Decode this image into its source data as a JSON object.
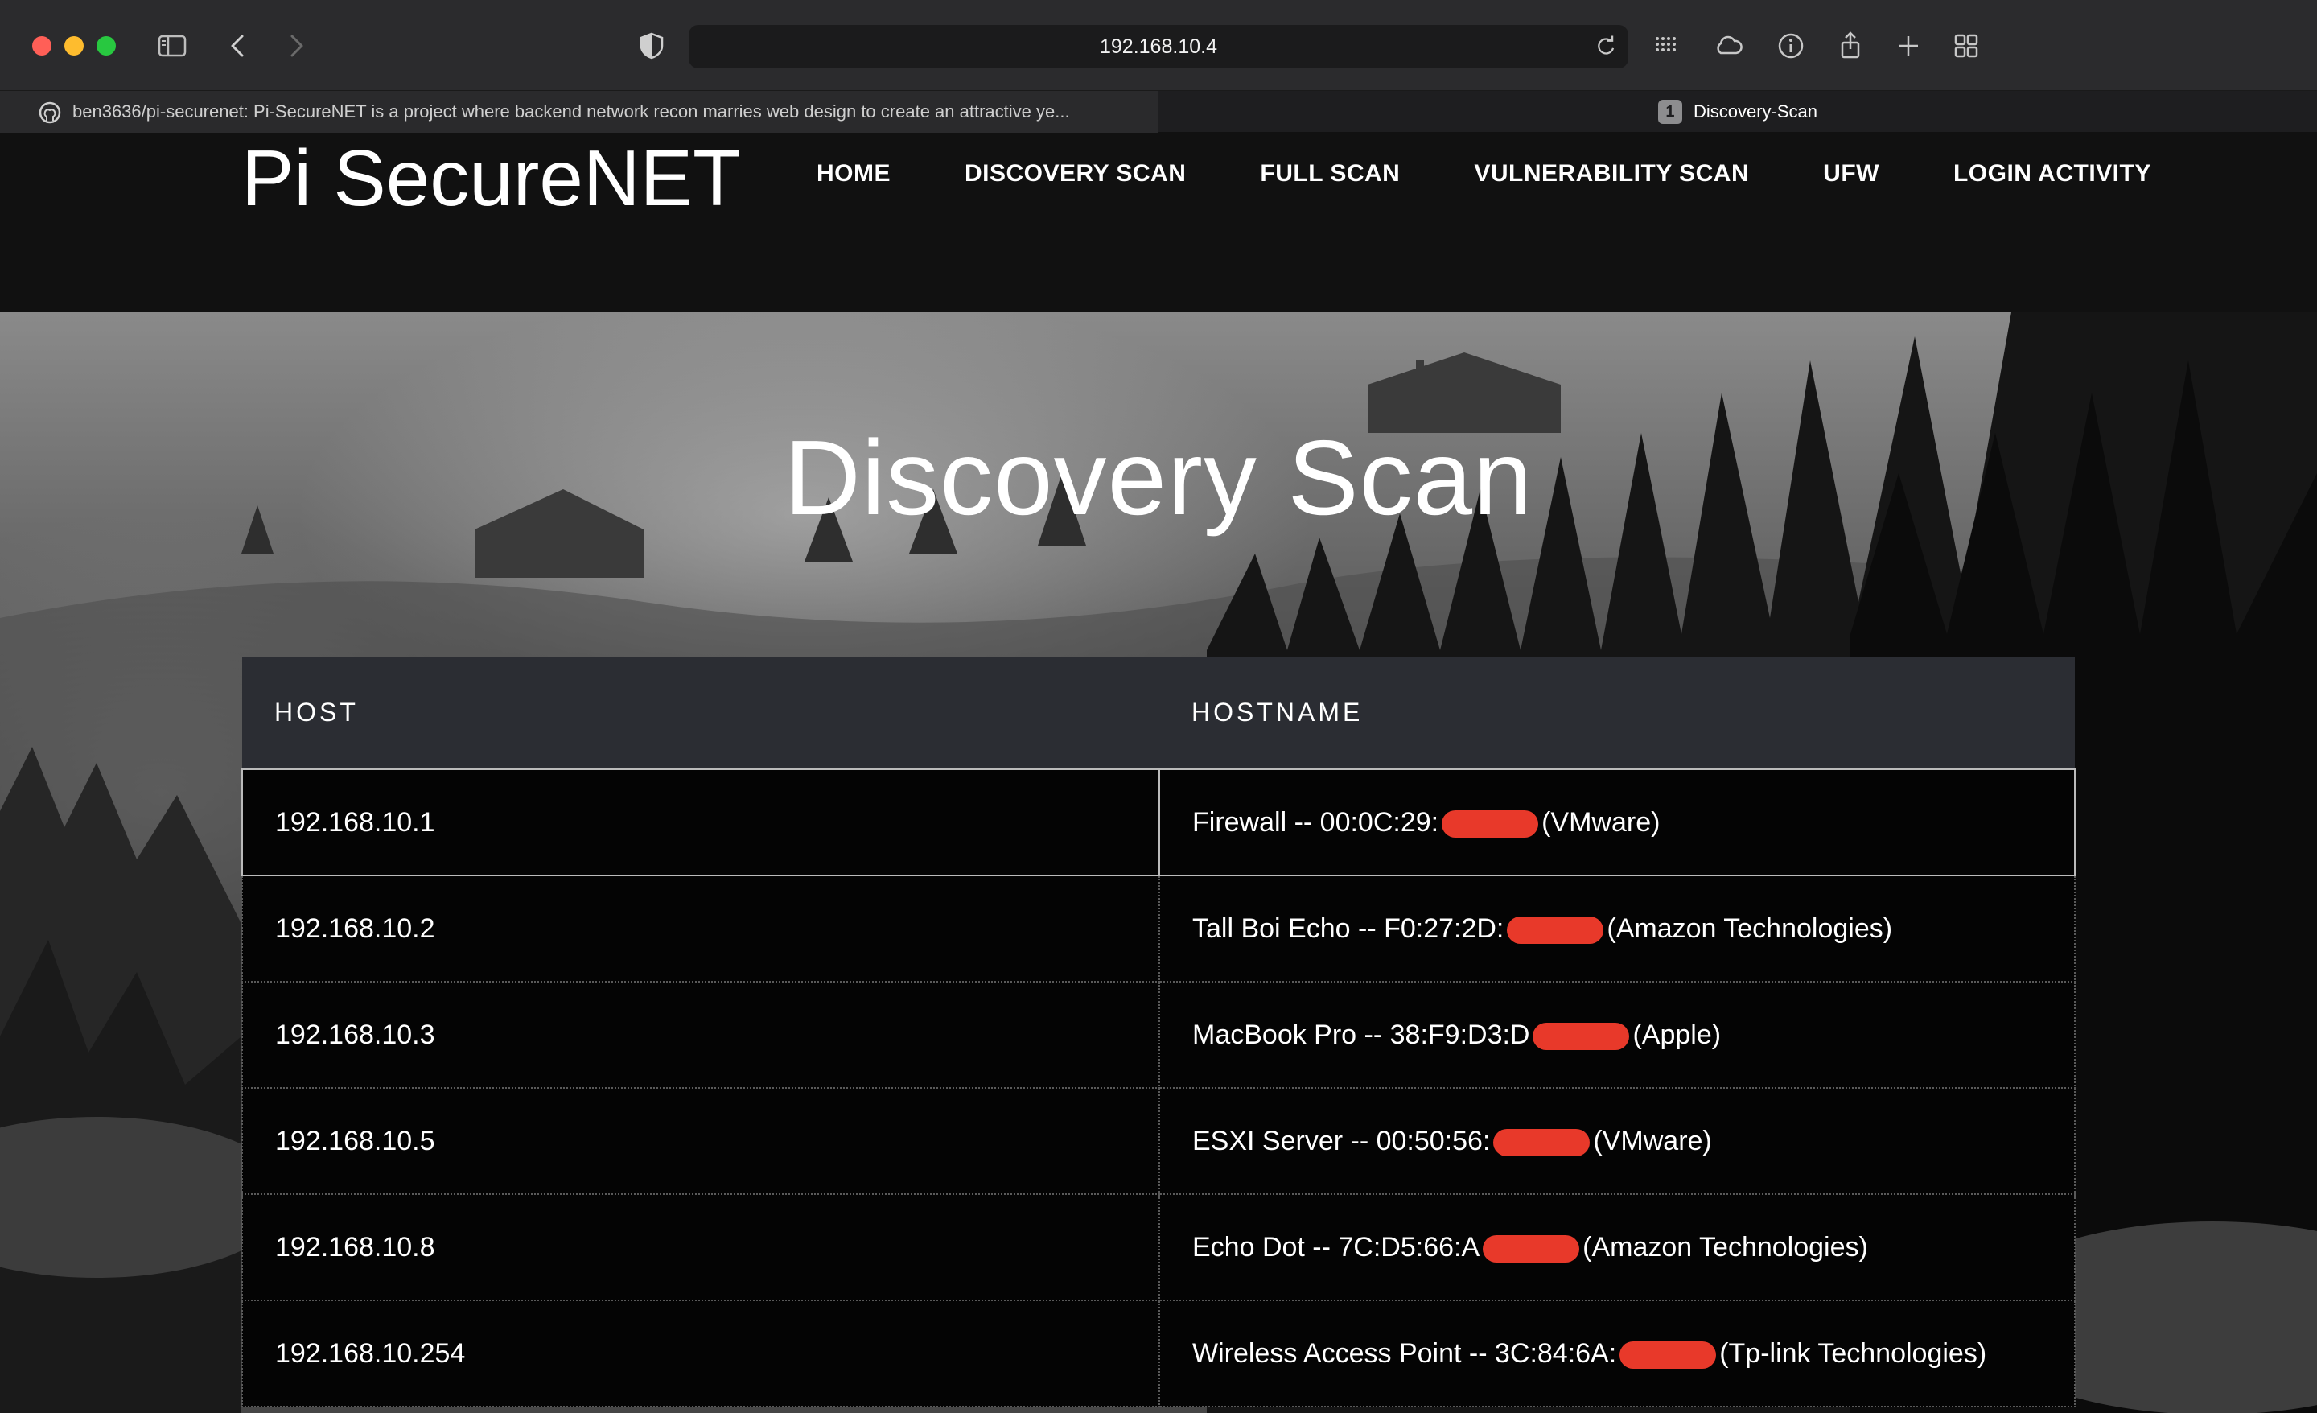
{
  "browser": {
    "url": "192.168.10.4",
    "tabs": [
      {
        "title": "ben3636/pi-securenet: Pi-SecureNET is a project where backend network recon marries web design to create an attractive ye...",
        "active": false
      },
      {
        "title": "Discovery-Scan",
        "active": true,
        "badge": "1"
      }
    ],
    "icons": [
      "sidebar-icon",
      "back-icon",
      "forward-icon",
      "shield-icon",
      "reload-icon",
      "extensions-grid-icon",
      "cloud-icon",
      "info-icon",
      "share-icon",
      "plus-icon",
      "tab-overview-icon"
    ]
  },
  "site": {
    "logo": "Pi SecureNET",
    "nav": [
      "HOME",
      "DISCOVERY SCAN",
      "FULL SCAN",
      "VULNERABILITY SCAN",
      "UFW",
      "LOGIN ACTIVITY"
    ]
  },
  "page": {
    "title": "Discovery Scan",
    "table": {
      "columns": [
        "HOST",
        "HOSTNAME"
      ],
      "rows": [
        {
          "host": "192.168.10.1",
          "name_prefix": "Firewall -- 00:0C:29:",
          "name_suffix": "(VMware)"
        },
        {
          "host": "192.168.10.2",
          "name_prefix": "Tall Boi Echo -- F0:27:2D:",
          "name_suffix": "(Amazon Technologies)"
        },
        {
          "host": "192.168.10.3",
          "name_prefix": "MacBook Pro -- 38:F9:D3:D",
          "name_suffix": "(Apple)"
        },
        {
          "host": "192.168.10.5",
          "name_prefix": "ESXI Server -- 00:50:56:",
          "name_suffix": "(VMware)"
        },
        {
          "host": "192.168.10.8",
          "name_prefix": "Echo Dot -- 7C:D5:66:A",
          "name_suffix": "(Amazon Technologies)"
        },
        {
          "host": "192.168.10.254",
          "name_prefix": "Wireless Access Point -- 3C:84:6A:",
          "name_suffix": "(Tp-link Technologies)"
        }
      ]
    }
  },
  "colors": {
    "redaction": "#e8392a",
    "table_header": "#2b2d33",
    "header_bg": "#111111"
  }
}
